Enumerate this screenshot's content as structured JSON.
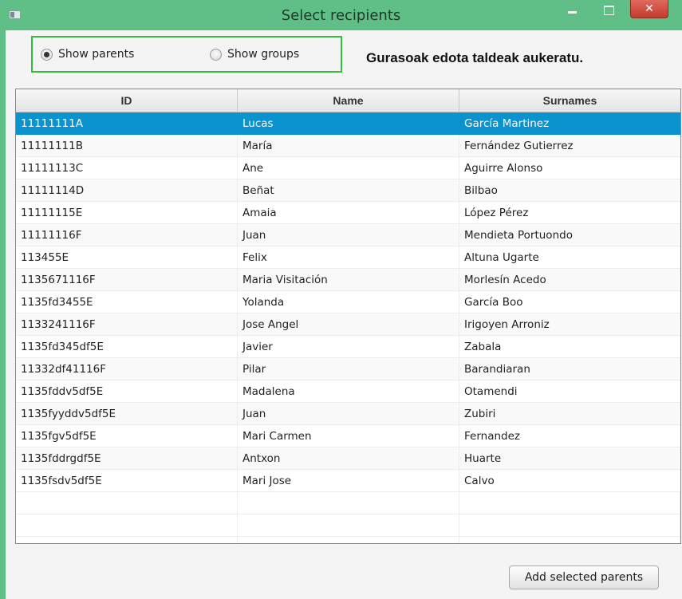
{
  "window": {
    "title": "Select recipients",
    "close_glyph": "✕"
  },
  "options": {
    "show_parents": "Show parents",
    "show_groups": "Show groups",
    "selected": "show_parents"
  },
  "hint": "Gurasoak edota taldeak aukeratu.",
  "table": {
    "columns": [
      "ID",
      "Name",
      "Surnames"
    ],
    "selected_row": 0,
    "rows": [
      [
        "11111111A",
        "Lucas",
        "García Martinez"
      ],
      [
        "11111111B",
        "María",
        "Fernández Gutierrez"
      ],
      [
        "11111113C",
        "Ane",
        "Aguirre Alonso"
      ],
      [
        "11111114D",
        "Beñat",
        "Bilbao"
      ],
      [
        "11111115E",
        "Amaia",
        "López Pérez"
      ],
      [
        "11111116F",
        "Juan",
        "Mendieta Portuondo"
      ],
      [
        "113455E",
        "Felix",
        "Altuna Ugarte"
      ],
      [
        "1135671116F",
        "Maria Visitación",
        "Morlesín Acedo"
      ],
      [
        "1135fd3455E",
        "Yolanda",
        "García Boo"
      ],
      [
        "1133241116F",
        "Jose Angel",
        "Irigoyen Arroniz"
      ],
      [
        "1135fd345df5E",
        "Javier",
        "Zabala"
      ],
      [
        "11332df41116F",
        "Pilar",
        "Barandiaran"
      ],
      [
        "1135fddv5df5E",
        "Madalena",
        "Otamendi"
      ],
      [
        "1135fyyddv5df5E",
        "Juan",
        "Zubiri"
      ],
      [
        "1135fgv5df5E",
        "Mari Carmen",
        "Fernandez"
      ],
      [
        "1135fddrgdf5E",
        "Antxon",
        "Huarte"
      ],
      [
        "1135fsdv5df5E",
        "Mari Jose",
        "Calvo"
      ]
    ]
  },
  "add_button": "Add selected parents",
  "colors": {
    "titlebar": "#5fbf86",
    "selection": "#0a93cc",
    "radio_group_border": "#2fbf3c"
  }
}
